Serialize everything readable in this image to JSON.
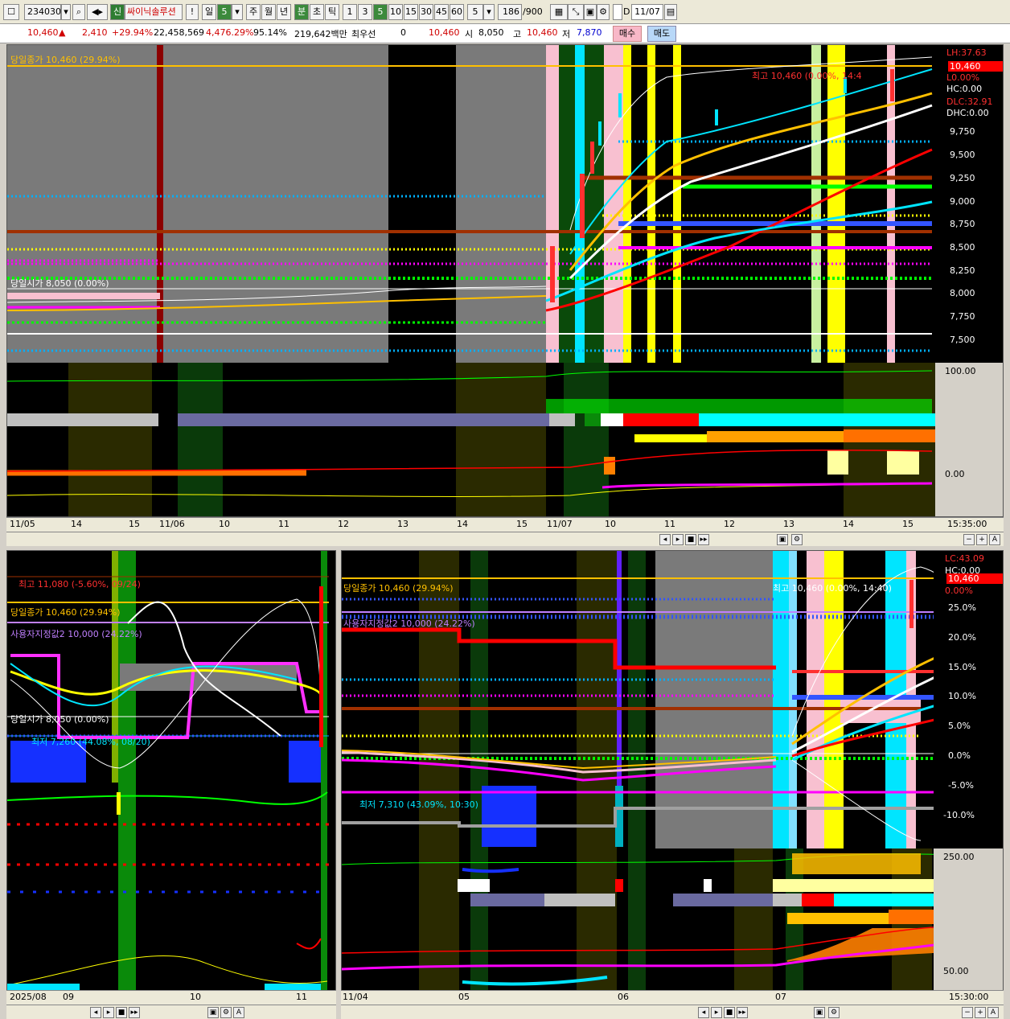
{
  "toolbar": {
    "code": "234030",
    "badge": "신",
    "name": "싸이닉솔루션",
    "excl": "!",
    "period": "일",
    "period_n": "5",
    "week": "주",
    "month": "월",
    "year": "년",
    "minute": "분",
    "second": "초",
    "tick": "틱",
    "intervals": [
      "1",
      "3",
      "5",
      "10",
      "15",
      "30",
      "45",
      "60"
    ],
    "count_sel": "5",
    "count": "186",
    "count_max": "/900",
    "date": "11/07"
  },
  "info": {
    "price": "10,460",
    "change": "2,410",
    "pct": "+29.94%",
    "volume": "22,458,569",
    "vol_pct": "4,476.29%",
    "rate": "95.14%",
    "amount": "219,642백만",
    "prio_label": "최우선",
    "prio_val": "0",
    "prio_price": "10,460",
    "open_label": "시",
    "open": "8,050",
    "high_label": "고",
    "high": "10,460",
    "low_label": "저",
    "low": "7,870",
    "buy": "매수",
    "sell": "매도"
  },
  "top": {
    "close_label": "당일종가 10,460 (29.94%)",
    "open_label": "당일시가 8,050 (0.00%)",
    "high_label": "최고 10,460 (0.00%, 14:4",
    "side": {
      "lh": "LH:37.63",
      "price": "10,460",
      "l": "L0.00%",
      "hc": "HC:0.00",
      "dlc": "DLC:32.91",
      "dhc": "DHC:0.00"
    },
    "y_ticks": [
      "9,750",
      "9,500",
      "9,250",
      "9,000",
      "8,750",
      "8,500",
      "8,250",
      "8,000",
      "7,750",
      "7,500"
    ],
    "ind_ticks": [
      "100.00",
      "0.00"
    ],
    "x_ticks": [
      "11/05",
      "14",
      "15",
      "11/06",
      "10",
      "11",
      "12",
      "13",
      "14",
      "15",
      "11/07",
      "10",
      "11",
      "12",
      "13",
      "14",
      "15"
    ],
    "time": "15:35:00"
  },
  "bl": {
    "high_label": "최고 11,080 (-5.60%, 09/24)",
    "close_label": "당일종가 10,460 (29.94%)",
    "user_label": "사용자지정값2 10,000 (24.22%)",
    "open_label": "당일시가 8,050 (0.00%)",
    "low_label": "최저 7,260 (44.08%, 08/20)",
    "x_ticks": [
      "2025/08",
      "09",
      "10",
      "11"
    ]
  },
  "br": {
    "close_label": "당일종가 10,460 (29.94%)",
    "user_label": "사용자지정값2 10,000 (24.22%)",
    "high_label": "최고 10,460 (0.00%, 14:40)",
    "low_label": "최저 7,310 (43.09%, 10:30)",
    "side": {
      "lc": "LC:43.09",
      "hc": "HC:0.00",
      "price": "10,460",
      "pct": "0.00%"
    },
    "y_ticks": [
      "25.0%",
      "20.0%",
      "15.0%",
      "10.0%",
      "5.0%",
      "0.0%",
      "-5.0%",
      "-10.0%"
    ],
    "ind_ticks": [
      "250.00",
      "50.00"
    ],
    "x_ticks": [
      "11/04",
      "05",
      "06",
      "07"
    ],
    "time": "15:30:00"
  },
  "colors": {
    "bg": "#000000",
    "gold": "#ffc000",
    "red": "#ff0000",
    "cyan": "#00e5ff",
    "magenta": "#ff00ff",
    "green": "#00ff00",
    "yellow": "#ffff00"
  }
}
